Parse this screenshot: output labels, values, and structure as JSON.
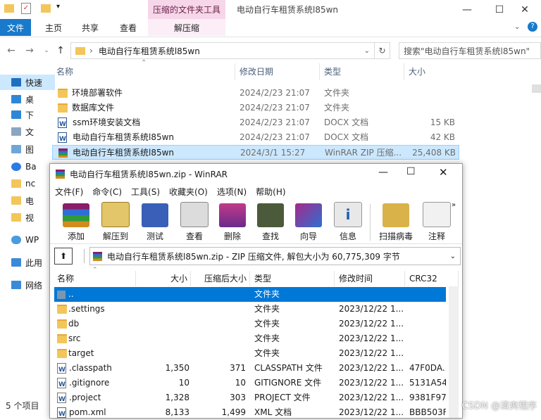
{
  "explorer": {
    "title": "电动自行车租赁系统l85wn",
    "context_tab_group": "压缩的文件夹工具",
    "ribbon_tabs": [
      "文件",
      "主页",
      "共享",
      "查看",
      "解压缩"
    ],
    "address_path": "电动自行车租赁系统l85wn",
    "search_placeholder": "搜索\"电动自行车租赁系统l85wn\"",
    "columns": [
      "名称",
      "修改日期",
      "类型",
      "大小"
    ],
    "files": [
      {
        "name": "环境部署软件",
        "date": "2024/2/23 21:07",
        "type": "文件夹",
        "size": "",
        "icon": "folder-icon"
      },
      {
        "name": "数据库文件",
        "date": "2024/2/23 21:07",
        "type": "文件夹",
        "size": "",
        "icon": "folder-icon"
      },
      {
        "name": "ssm环境安装文档",
        "date": "2024/2/23 21:07",
        "type": "DOCX 文档",
        "size": "15 KB",
        "icon": "docx-icon"
      },
      {
        "name": "电动自行车租赁系统l85wn",
        "date": "2024/2/23 21:07",
        "type": "DOCX 文档",
        "size": "42 KB",
        "icon": "docx-icon"
      },
      {
        "name": "电动自行车租赁系统l85wn",
        "date": "2024/3/1 15:27",
        "type": "WinRAR ZIP 压缩...",
        "size": "25,408 KB",
        "icon": "winrar-zip-icon"
      }
    ],
    "nav_items": [
      "快速",
      "桌",
      "下",
      "文",
      "图",
      "Ba",
      "nc",
      "电",
      "视",
      "WP",
      "此用",
      "网络"
    ],
    "status": "5 个项目"
  },
  "winrar": {
    "title": "电动自行车租赁系统l85wn.zip - WinRAR",
    "menu": [
      "文件(F)",
      "命令(C)",
      "工具(S)",
      "收藏夹(O)",
      "选项(N)",
      "帮助(H)"
    ],
    "toolbar": [
      "添加",
      "解压到",
      "测试",
      "查看",
      "删除",
      "查找",
      "向导",
      "信息",
      "扫描病毒",
      "注释"
    ],
    "path_text": "电动自行车租赁系统l85wn.zip - ZIP 压缩文件, 解包大小为 60,775,309 字节",
    "columns": [
      "名称",
      "大小",
      "压缩后大小",
      "类型",
      "修改时间",
      "CRC32"
    ],
    "rows": [
      {
        "name": "..",
        "size": "",
        "packed": "",
        "type": "文件夹",
        "modified": "",
        "crc": "",
        "icon": "up-folder-icon"
      },
      {
        "name": ".settings",
        "size": "",
        "packed": "",
        "type": "文件夹",
        "modified": "2023/12/22 1...",
        "crc": "",
        "icon": "folder-icon"
      },
      {
        "name": "db",
        "size": "",
        "packed": "",
        "type": "文件夹",
        "modified": "2023/12/22 1...",
        "crc": "",
        "icon": "folder-icon"
      },
      {
        "name": "src",
        "size": "",
        "packed": "",
        "type": "文件夹",
        "modified": "2023/12/22 1...",
        "crc": "",
        "icon": "folder-icon"
      },
      {
        "name": "target",
        "size": "",
        "packed": "",
        "type": "文件夹",
        "modified": "2023/12/22 1...",
        "crc": "",
        "icon": "folder-icon"
      },
      {
        "name": ".classpath",
        "size": "1,350",
        "packed": "371",
        "type": "CLASSPATH 文件",
        "modified": "2023/12/22 1...",
        "crc": "47F0DA...",
        "icon": "file-icon"
      },
      {
        "name": ".gitignore",
        "size": "10",
        "packed": "10",
        "type": "GITIGNORE 文件",
        "modified": "2023/12/22 1...",
        "crc": "5131A54I",
        "icon": "file-icon"
      },
      {
        "name": ".project",
        "size": "1,328",
        "packed": "303",
        "type": "PROJECT 文件",
        "modified": "2023/12/22 1...",
        "crc": "9381F97",
        "icon": "file-icon"
      },
      {
        "name": "pom.xml",
        "size": "8,133",
        "packed": "1,499",
        "type": "XML 文档",
        "modified": "2023/12/22 1...",
        "crc": "BBB503F",
        "icon": "xml-icon"
      }
    ]
  },
  "watermark": "CSDN @清爽程序",
  "colors": {
    "accent": "#0078d7",
    "file_tab": "#1979ca",
    "context_tab": "#f6d7e9"
  }
}
